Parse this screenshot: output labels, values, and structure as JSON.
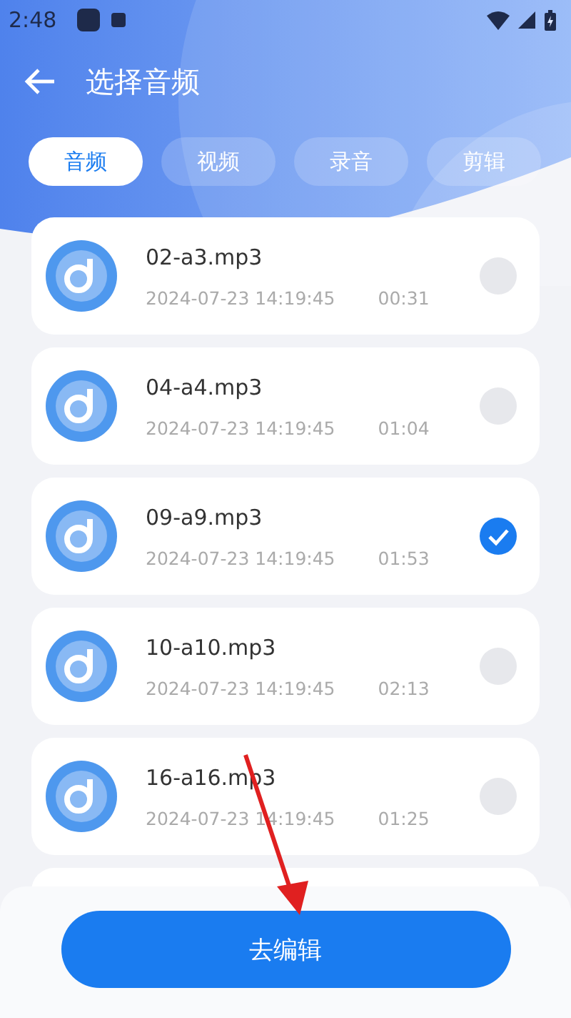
{
  "status_bar": {
    "time": "2:48"
  },
  "header": {
    "title": "选择音频"
  },
  "tabs": [
    {
      "label": "音频",
      "selected": true
    },
    {
      "label": "视频",
      "selected": false
    },
    {
      "label": "录音",
      "selected": false
    },
    {
      "label": "剪辑",
      "selected": false
    }
  ],
  "files": [
    {
      "name": "02-a3.mp3",
      "date": "2024-07-23 14:19:45",
      "duration": "00:31",
      "selected": false
    },
    {
      "name": "04-a4.mp3",
      "date": "2024-07-23 14:19:45",
      "duration": "01:04",
      "selected": false
    },
    {
      "name": "09-a9.mp3",
      "date": "2024-07-23 14:19:45",
      "duration": "01:53",
      "selected": true
    },
    {
      "name": "10-a10.mp3",
      "date": "2024-07-23 14:19:45",
      "duration": "02:13",
      "selected": false
    },
    {
      "name": "16-a16.mp3",
      "date": "2024-07-23 14:19:45",
      "duration": "01:25",
      "selected": false
    }
  ],
  "primary_button": {
    "label": "去编辑"
  }
}
